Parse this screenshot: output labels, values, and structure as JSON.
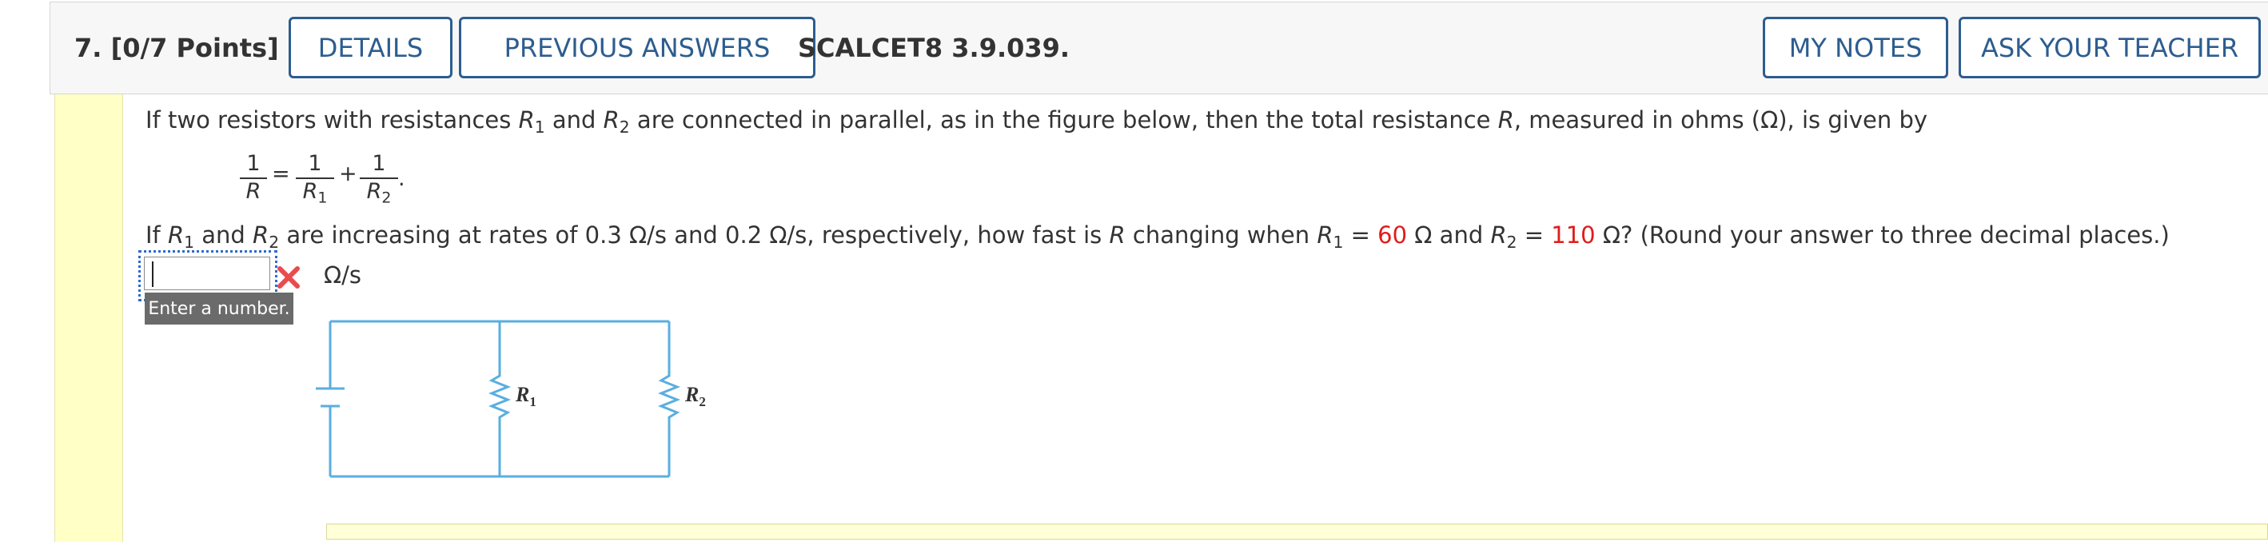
{
  "header": {
    "question_label": "7.  [0/7 Points]",
    "details_label": "DETAILS",
    "previous_answers_label": "PREVIOUS ANSWERS",
    "question_code": "SCALCET8 3.9.039.",
    "my_notes_label": "MY NOTES",
    "ask_teacher_label": "ASK YOUR TEACHER"
  },
  "problem": {
    "intro_a": "If two resistors with resistances ",
    "r1_sym": "R",
    "r1_sub": "1",
    "intro_b": " and ",
    "r2_sym": "R",
    "r2_sub": "2",
    "intro_c": " are connected in parallel, as in the figure below, then the total resistance ",
    "r_sym": "R",
    "intro_d": ", measured in ohms (Ω), is given by",
    "formula": {
      "one": "1",
      "r": "R",
      "equals": "=",
      "plus": "+",
      "r1": "R",
      "r1_sub": "1",
      "r2": "R",
      "r2_sub": "2",
      "period": "."
    },
    "q_a": "If ",
    "q_b": " and ",
    "q_c": " are increasing at rates of 0.3 Ω/s and 0.2 Ω/s, respectively, how fast is ",
    "q_d": " changing when ",
    "q_eq": " = ",
    "r1_value": "60",
    "q_ohm_and": " Ω and ",
    "r2_value": "110",
    "q_e": " Ω? (Round your answer to three decimal places.)"
  },
  "answer": {
    "value": "",
    "units": "Ω/s",
    "status": "incorrect",
    "tooltip": "Enter a number."
  },
  "circuit": {
    "label_r1": "R",
    "label_r1_sub": "1",
    "label_r2": "R",
    "label_r2_sub": "2"
  },
  "colors": {
    "accent": "#2d5d8f",
    "given_value": "#e01c1c",
    "wire": "#5aaee0",
    "side_strip": "#ffffc6"
  }
}
